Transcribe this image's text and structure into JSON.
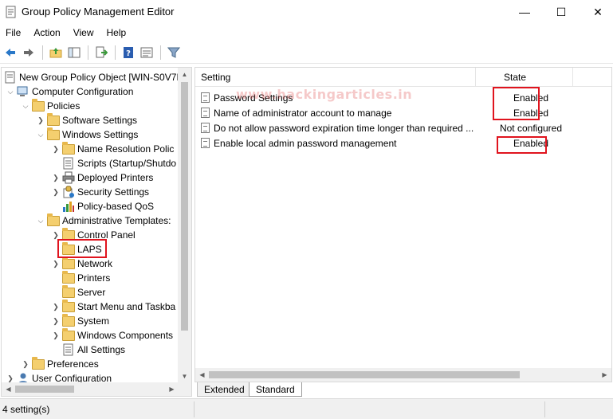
{
  "window": {
    "title": "Group Policy Management Editor",
    "minimize_glyph": "—",
    "maximize_glyph": "☐",
    "close_glyph": "✕"
  },
  "menu": [
    "File",
    "Action",
    "View",
    "Help"
  ],
  "toolbar_icons": [
    "back-arrow-icon",
    "forward-arrow-icon",
    "up-folder-icon",
    "show-hide-tree-icon",
    "export-list-icon",
    "help-icon",
    "properties-icon",
    "filter-icon"
  ],
  "tree": {
    "root": "New Group Policy Object [WIN-S0V7I",
    "computer_configuration": "Computer Configuration",
    "policies": "Policies",
    "software_settings": "Software Settings",
    "windows_settings": "Windows Settings",
    "name_resolution": "Name Resolution Polic",
    "scripts": "Scripts (Startup/Shutdo",
    "deployed_printers": "Deployed Printers",
    "security_settings": "Security Settings",
    "policy_qos": "Policy-based QoS",
    "admin_templates": "Administrative Templates:",
    "control_panel": "Control Panel",
    "laps": "LAPS",
    "network": "Network",
    "printers": "Printers",
    "server": "Server",
    "start_menu": "Start Menu and Taskba",
    "system": "System",
    "windows_components": "Windows Components",
    "all_settings": "All Settings",
    "preferences": "Preferences",
    "user_configuration": "User Configuration"
  },
  "list": {
    "columns": {
      "setting": "Setting",
      "state": "State"
    },
    "rows": [
      {
        "name": "Password Settings",
        "state": "Enabled"
      },
      {
        "name": "Name of administrator account to manage",
        "state": "Enabled"
      },
      {
        "name": "Do not allow password expiration time longer than required ...",
        "state": "Not configured"
      },
      {
        "name": "Enable local admin password management",
        "state": "Enabled"
      }
    ]
  },
  "tabs": {
    "extended": "Extended",
    "standard": "Standard",
    "active": "Standard"
  },
  "status": {
    "text": "4 setting(s)"
  },
  "watermark": "www.hackingarticles.in",
  "colors": {
    "highlight_box": "#e0141e",
    "folder": "#f4cf6f"
  }
}
